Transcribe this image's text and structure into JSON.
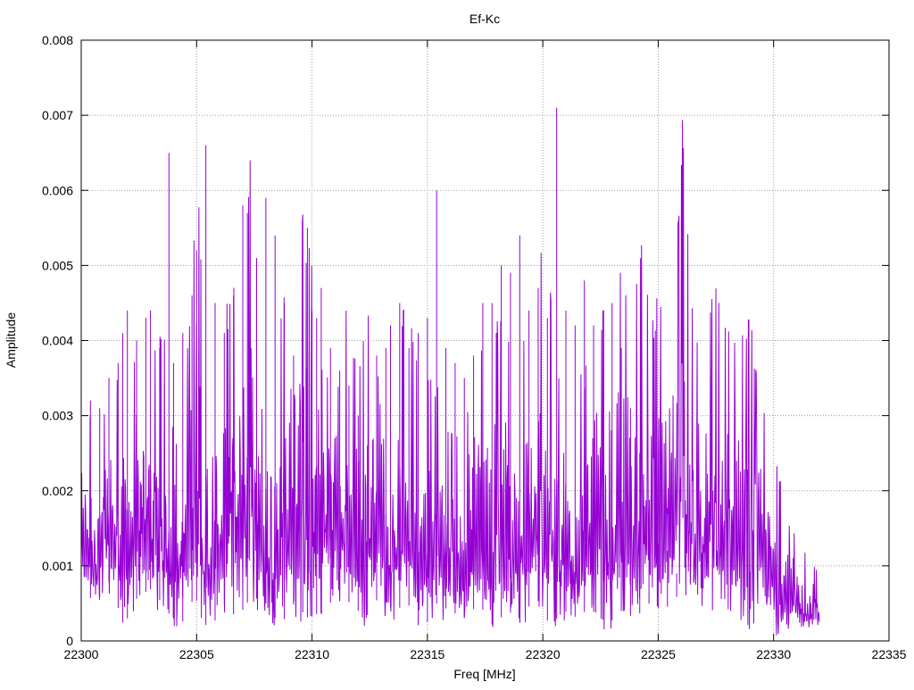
{
  "chart_data": {
    "type": "line",
    "title": "Ef-Kc",
    "xlabel": "Freq [MHz]",
    "ylabel": "Amplitude",
    "xlim": [
      22300,
      22335
    ],
    "ylim": [
      0,
      0.008
    ],
    "x_ticks": [
      22300,
      22305,
      22310,
      22315,
      22320,
      22325,
      22330,
      22335
    ],
    "x_tick_labels": [
      "22300",
      "22305",
      "22310",
      "22315",
      "22320",
      "22325",
      "22330",
      "22335"
    ],
    "y_ticks": [
      0,
      0.001,
      0.002,
      0.003,
      0.004,
      0.005,
      0.006,
      0.007,
      0.008
    ],
    "y_tick_labels": [
      "0",
      "0.001",
      "0.002",
      "0.003",
      "0.004",
      "0.005",
      "0.006",
      "0.007",
      "0.008"
    ],
    "grid": true,
    "series": [
      {
        "color": "#9400d3",
        "x_start": 22300,
        "x_end": 22332,
        "x": [
          22300.0,
          22300.4,
          22300.8,
          22301.2,
          22301.6,
          22301.8,
          22302.0,
          22302.4,
          22302.8,
          22303.0,
          22303.4,
          22303.8,
          22304.0,
          22304.4,
          22304.8,
          22305.0,
          22305.4,
          22305.8,
          22306.2,
          22306.6,
          22307.0,
          22307.2,
          22307.6,
          22308.0,
          22308.4,
          22308.8,
          22309.2,
          22309.6,
          22309.8,
          22310.0,
          22310.2,
          22310.4,
          22310.8,
          22311.2,
          22311.6,
          22312.0,
          22312.4,
          22312.8,
          22313.2,
          22313.4,
          22313.8,
          22314.2,
          22314.6,
          22315.0,
          22315.4,
          22315.8,
          22316.2,
          22316.6,
          22317.0,
          22317.4,
          22317.8,
          22318.2,
          22318.6,
          22319.0,
          22319.4,
          22319.8,
          22320.2,
          22320.6,
          22321.0,
          22321.4,
          22321.8,
          22322.2,
          22322.6,
          22323.0,
          22323.4,
          22323.8,
          22324.2,
          22324.6,
          22325.0,
          22325.4,
          22325.8,
          22326.2,
          22326.6,
          22327.0,
          22327.4,
          22327.8,
          22328.2,
          22328.6,
          22329.0,
          22329.4,
          22329.8,
          22330.2,
          22330.6,
          22331.0,
          22331.4,
          22331.8,
          22332.0
        ],
        "peaks": [
          0.0029,
          0.0032,
          0.0031,
          0.0035,
          0.0037,
          0.0041,
          0.0044,
          0.004,
          0.0043,
          0.0044,
          0.0039,
          0.0065,
          0.0037,
          0.0041,
          0.0046,
          0.0052,
          0.0066,
          0.0045,
          0.0041,
          0.0046,
          0.0058,
          0.0057,
          0.0051,
          0.0059,
          0.0054,
          0.0045,
          0.0038,
          0.0042,
          0.0055,
          0.0044,
          0.0043,
          0.0047,
          0.0039,
          0.0036,
          0.0034,
          0.003,
          0.0026,
          0.0038,
          0.0039,
          0.0042,
          0.0045,
          0.0039,
          0.0041,
          0.0043,
          0.006,
          0.0039,
          0.0037,
          0.0035,
          0.0038,
          0.0045,
          0.0045,
          0.005,
          0.0049,
          0.0054,
          0.0044,
          0.0047,
          0.0043,
          0.0071,
          0.0044,
          0.0042,
          0.0048,
          0.0042,
          0.0044,
          0.0045,
          0.0039,
          0.0031,
          0.0025,
          0.0017,
          0.0013,
          0.0012,
          0.0009
        ],
        "troughs": [
          0.0007,
          0.0005,
          0.0008,
          0.0002,
          0.0006,
          0.0007,
          0.0004,
          0.0002,
          0.0006,
          0.0001,
          0.0005,
          0.0003,
          0.0006,
          0.0005,
          0.0002,
          0.0005,
          0.0003,
          0.0004,
          0.0006,
          0.0005,
          0.0003,
          0.0006,
          0.0004,
          0.0005,
          0.0001,
          0.0005,
          0.0004,
          0.0003,
          0.0005,
          0.0002,
          0.0004,
          0.0003,
          0.0006,
          0.0002,
          0.0004,
          0.0003,
          0.0005,
          0.0002,
          0.0004,
          0.0003,
          0.0005,
          0.0004,
          0.0006,
          0.0005,
          0.0004,
          0.0003,
          0.0005,
          0.0002,
          0.0004,
          0.0001,
          0.0002,
          0.0001,
          0.0002
        ]
      }
    ]
  }
}
